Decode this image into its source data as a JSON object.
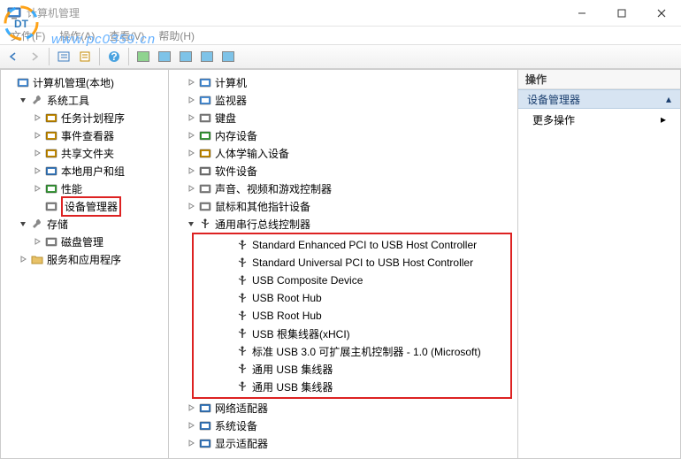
{
  "window": {
    "title": "计算机管理"
  },
  "menu": {
    "file": "文件(F)",
    "action": "操作(A)",
    "view": "查看(V)",
    "help": "帮助(H)"
  },
  "watermark": "www.pc0359.cn",
  "left_tree": {
    "root": "计算机管理(本地)",
    "groups": [
      {
        "label": "系统工具",
        "expanded": true,
        "children": [
          {
            "label": "任务计划程序",
            "icon": "clock"
          },
          {
            "label": "事件查看器",
            "icon": "event"
          },
          {
            "label": "共享文件夹",
            "icon": "share"
          },
          {
            "label": "本地用户和组",
            "icon": "users"
          },
          {
            "label": "性能",
            "icon": "perf"
          },
          {
            "label": "设备管理器",
            "icon": "device",
            "highlighted": true
          }
        ]
      },
      {
        "label": "存储",
        "expanded": true,
        "children": [
          {
            "label": "磁盘管理",
            "icon": "disk"
          }
        ]
      },
      {
        "label": "服务和应用程序",
        "expanded": false,
        "children": []
      }
    ]
  },
  "center_tree": {
    "items": [
      {
        "label": "计算机",
        "icon": "computer"
      },
      {
        "label": "监视器",
        "icon": "monitor"
      },
      {
        "label": "键盘",
        "icon": "keyboard"
      },
      {
        "label": "内存设备",
        "icon": "memory"
      },
      {
        "label": "人体学输入设备",
        "icon": "hid"
      },
      {
        "label": "软件设备",
        "icon": "software"
      },
      {
        "label": "声音、视频和游戏控制器",
        "icon": "sound"
      },
      {
        "label": "鼠标和其他指针设备",
        "icon": "mouse"
      },
      {
        "label": "通用串行总线控制器",
        "icon": "usb",
        "expanded": true,
        "children": [
          "Standard Enhanced PCI to USB Host Controller",
          "Standard Universal PCI to USB Host Controller",
          "USB Composite Device",
          "USB Root Hub",
          "USB Root Hub",
          "USB 根集线器(xHCI)",
          "标准 USB 3.0 可扩展主机控制器 - 1.0 (Microsoft)",
          "通用 USB 集线器",
          "通用 USB 集线器"
        ]
      },
      {
        "label": "网络适配器",
        "icon": "network"
      },
      {
        "label": "系统设备",
        "icon": "system"
      },
      {
        "label": "显示适配器",
        "icon": "display"
      }
    ]
  },
  "actions": {
    "header": "操作",
    "section": "设备管理器",
    "more": "更多操作"
  }
}
